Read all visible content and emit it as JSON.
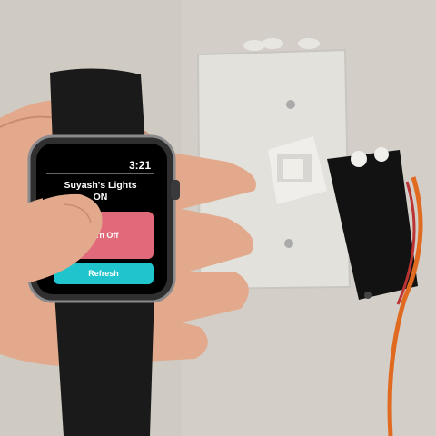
{
  "watch": {
    "time": "3:21",
    "title_line1": "Suyash's Lights",
    "title_line2": "ON",
    "turn_off_label": "Turn Off",
    "refresh_label": "Refresh"
  },
  "colors": {
    "wall": "#cfcac2",
    "switch_plate": "#e3e1dc",
    "servo": "#121212",
    "turn_off_button": "#e06a7a",
    "refresh_button": "#20c4cc",
    "wire_orange": "#e06a20",
    "skin": "#e2a98d"
  },
  "icons": [
    "hand",
    "watch-crown-icon",
    "servo-motor",
    "switch-plate"
  ]
}
